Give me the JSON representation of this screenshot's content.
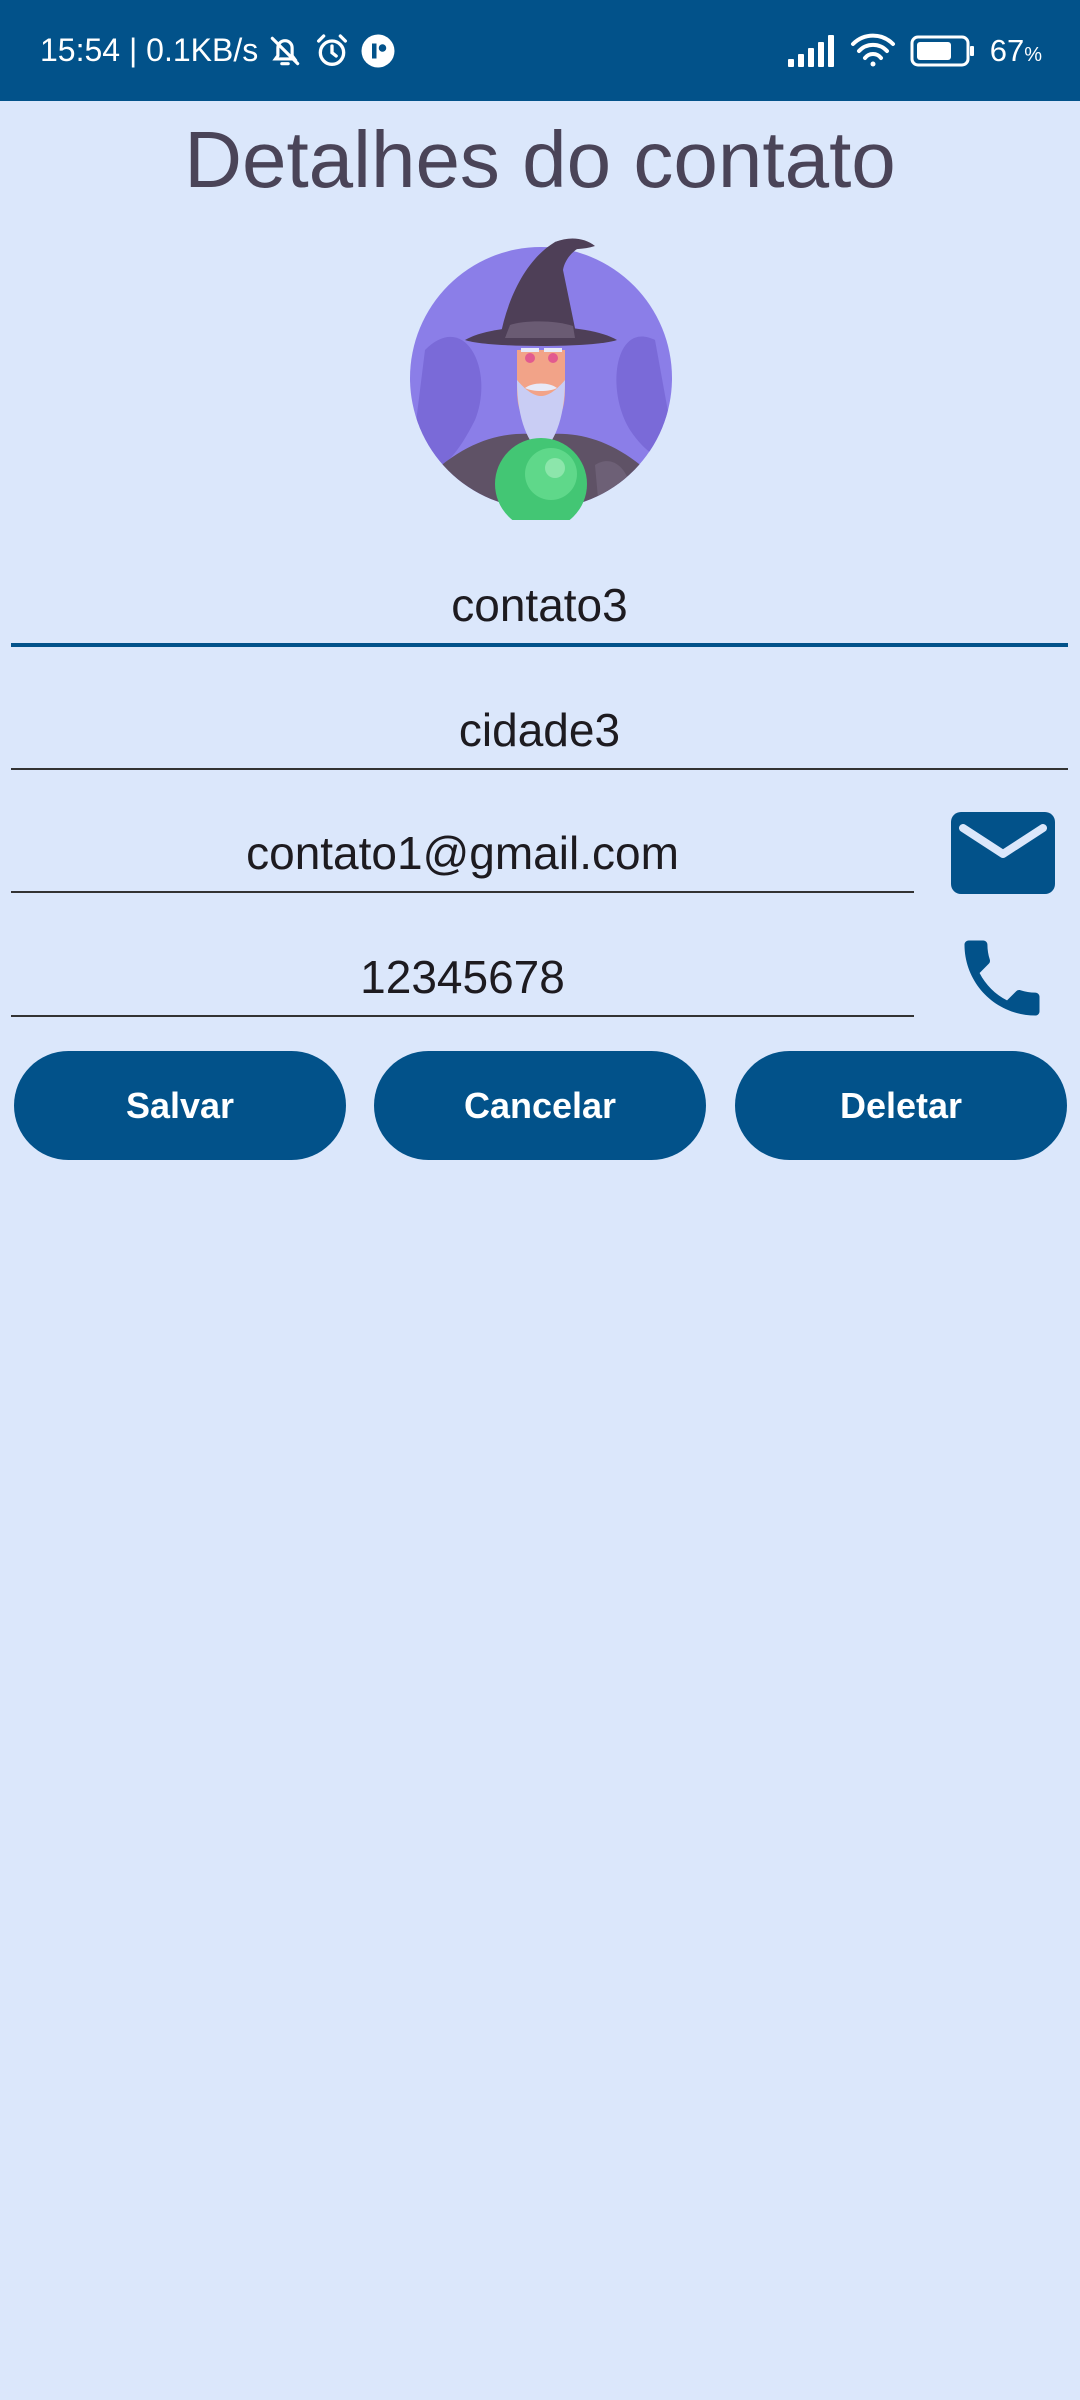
{
  "status_bar": {
    "time_speed": "15:54 | 0.1KB/s",
    "battery_value": "67",
    "battery_unit": "%"
  },
  "page": {
    "title": "Detalhes do contato"
  },
  "avatar": {
    "icon": "wizard-avatar"
  },
  "form": {
    "name": "contato3",
    "city": "cidade3",
    "email": "contato1@gmail.com",
    "phone": "12345678"
  },
  "actions": {
    "save_label": "Salvar",
    "cancel_label": "Cancelar",
    "delete_label": "Deletar"
  },
  "colors": {
    "primary": "#02528a",
    "background": "#dbe7fb",
    "title_text": "#4a4458"
  }
}
